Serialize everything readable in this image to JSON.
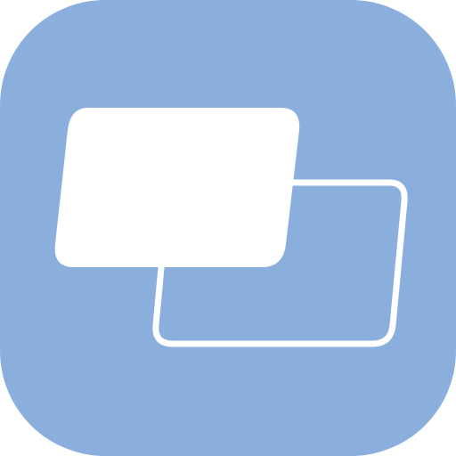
{
  "icon": {
    "name": "overlapping-windows-icon",
    "background_color": "#8BAFDD",
    "foreground_color": "#FFFFFF"
  }
}
